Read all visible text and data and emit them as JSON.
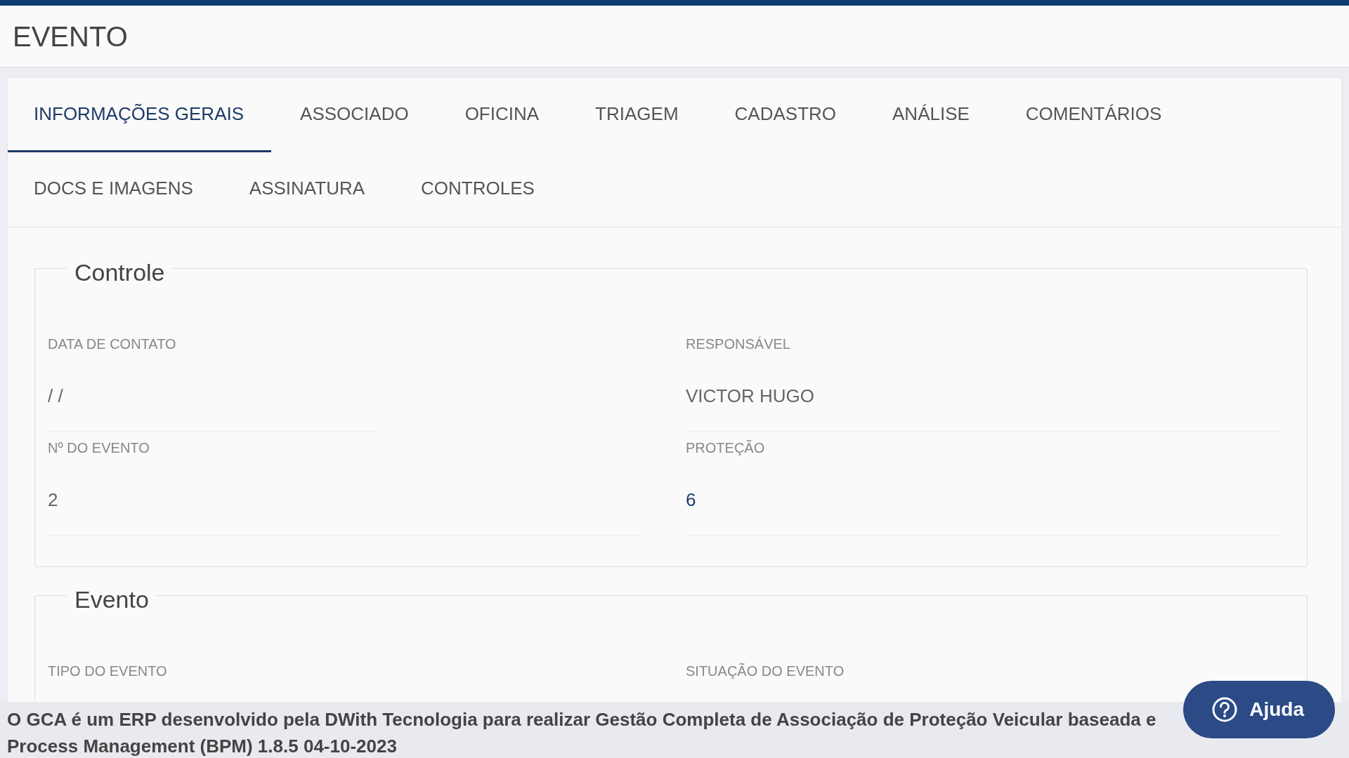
{
  "page": {
    "title": "EVENTO"
  },
  "tabs": [
    {
      "label": "INFORMAÇÕES GERAIS",
      "selected": true
    },
    {
      "label": "ASSOCIADO",
      "selected": false
    },
    {
      "label": "OFICINA",
      "selected": false
    },
    {
      "label": "TRIAGEM",
      "selected": false
    },
    {
      "label": "CADASTRO",
      "selected": false
    },
    {
      "label": "ANÁLISE",
      "selected": false
    },
    {
      "label": "COMENTÁRIOS",
      "selected": false
    },
    {
      "label": "DOCS E IMAGENS",
      "selected": false
    },
    {
      "label": "ASSINATURA",
      "selected": false
    },
    {
      "label": "CONTROLES",
      "selected": false
    }
  ],
  "sections": [
    {
      "legend": "Controle",
      "fields": [
        {
          "label": "DATA DE CONTATO",
          "value": "/ /",
          "kind": "text"
        },
        {
          "label": "RESPONSÁVEL",
          "value": "VICTOR HUGO",
          "kind": "text"
        },
        {
          "label": "Nº DO EVENTO",
          "value": "2",
          "kind": "text"
        },
        {
          "label": "PROTEÇÃO",
          "value": "6",
          "kind": "link"
        }
      ]
    },
    {
      "legend": "Evento",
      "fields": [
        {
          "label": "TIPO DO EVENTO"
        },
        {
          "label": "SITUAÇÃO DO EVENTO"
        }
      ]
    }
  ],
  "footer": {
    "lines": [
      "O GCA é um ERP desenvolvido pela DWith Tecnologia para realizar Gestão Completa de Associação de Proteção Veicular baseada e",
      "Process Management (BPM) 1.8.5 04-10-2023"
    ]
  },
  "help_button": {
    "label": "Ajuda"
  }
}
